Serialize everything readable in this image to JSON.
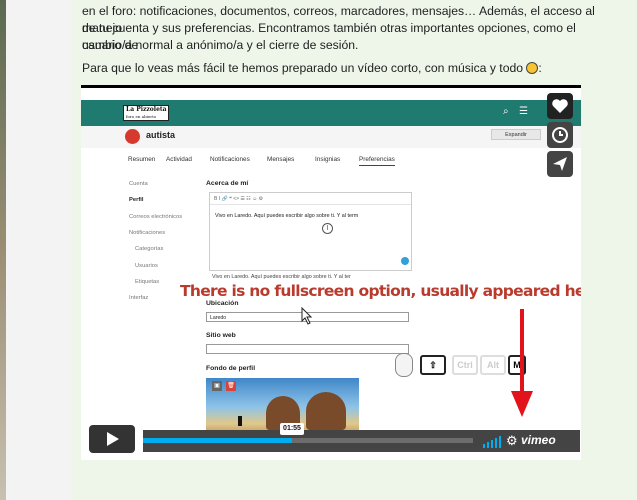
{
  "post": {
    "paragraph1_line1": "en el foro: notificaciones, documentos, correos, marcadores, mensajes… Además, el acceso al manejo",
    "paragraph1_line2": "de tu cuenta y sus preferencias. Encontramos también otras importantes opciones, como el cambio de",
    "paragraph1_line3": "usuario/a normal a anónimo/a y el cierre de sesión.",
    "paragraph2": "Para que lo veas más fácil te hemos preparado un vídeo corto, con música y todo"
  },
  "forum": {
    "logo_line1": "La Pizzoleta",
    "logo_line2": "foro en abierto",
    "username": "autista",
    "expand_label": "Expandir",
    "tabs": [
      "Resumen",
      "Actividad",
      "Notificaciones",
      "Mensajes",
      "Insignias",
      "Preferencias"
    ],
    "sidebar": [
      "Cuenta",
      "Perfil",
      "Correos electrónicos",
      "Notificaciones",
      "Categorías",
      "Usuarios",
      "Etiquetas",
      "Interfaz"
    ],
    "about_label": "Acerca de mí",
    "toolbar_glyphs": "B  I  🔗  ❝  <>  ☰  ☷  ☺  ⚙",
    "about_text": "Vivo en Laredo. Aquí puedes escribir algo sobre ti. Y al term",
    "preview_text": "Vivo en Laredo. Aquí puedes escribir algo sobre ti. Y al ter",
    "location_label": "Ubicación",
    "location_value": "Laredo",
    "website_label": "Sitio web",
    "website_value": "",
    "background_label": "Fondo de perfil"
  },
  "keys": [
    "⇧",
    "Ctrl",
    "Alt",
    "M"
  ],
  "annotation": "There is no fullscreen option, usually appeared here.",
  "player": {
    "time": "01:55",
    "progress": 0.34,
    "brand": "vimeo"
  },
  "colors": {
    "forum_header": "#1f7a6f",
    "annotation": "#b83b2e",
    "progress": "#00adef"
  },
  "icons": [
    "heart-icon",
    "clock-icon",
    "send-icon",
    "play-icon",
    "settings-gear-icon",
    "volume-icon",
    "search-icon",
    "menu-icon"
  ]
}
